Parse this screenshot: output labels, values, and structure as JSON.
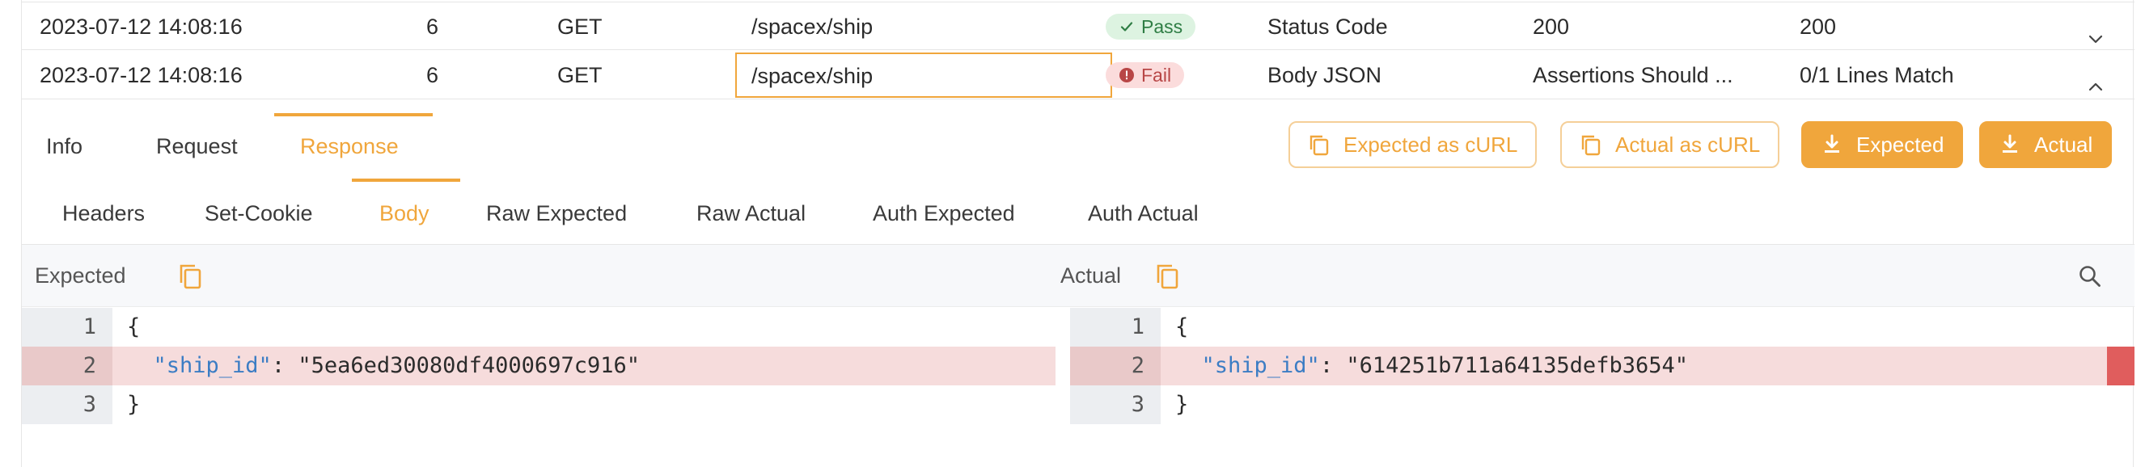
{
  "rows": [
    {
      "time": "2023-07-12 14:08:16",
      "num": "6",
      "method": "GET",
      "path": "/spacex/ship",
      "status": "Pass",
      "type": "Status Code",
      "expected": "200",
      "actual": "200",
      "chevron_icon": "chevron-down-icon"
    },
    {
      "time": "2023-07-12 14:08:16",
      "num": "6",
      "method": "GET",
      "path": "/spacex/ship",
      "status": "Fail",
      "type": "Body JSON",
      "expected": "Assertions Should ...",
      "actual": "0/1 Lines Match",
      "chevron_icon": "chevron-up-icon"
    }
  ],
  "tabs": [
    {
      "label": "Info"
    },
    {
      "label": "Request"
    },
    {
      "label": "Response",
      "active": true
    }
  ],
  "actions": {
    "expected_curl": "Expected as cURL",
    "actual_curl": "Actual as cURL",
    "expected": "Expected",
    "actual": "Actual"
  },
  "sub_tabs": [
    {
      "label": "Headers"
    },
    {
      "label": "Set-Cookie"
    },
    {
      "label": "Body",
      "active": true
    },
    {
      "label": "Raw Expected"
    },
    {
      "label": "Raw Actual"
    },
    {
      "label": "Auth Expected"
    },
    {
      "label": "Auth Actual"
    }
  ],
  "diff": {
    "expected_title": "Expected",
    "actual_title": "Actual",
    "expected_lines": [
      {
        "n": "1",
        "text": "{"
      },
      {
        "n": "2",
        "key": "\"ship_id\"",
        "rest": ": \"5ea6ed30080df4000697c916\"",
        "changed": true
      },
      {
        "n": "3",
        "text": "}"
      }
    ],
    "actual_lines": [
      {
        "n": "1",
        "text": "{"
      },
      {
        "n": "2",
        "key": "\"ship_id\"",
        "rest": ": \"614251b711a64135defb3654\"",
        "changed": true
      },
      {
        "n": "3",
        "text": "}"
      }
    ]
  },
  "colors": {
    "accent": "#f0a63c",
    "pass_bg": "#ddf3e1",
    "fail_bg": "#fbdcdc",
    "diff_changed": "#f6dcdc",
    "json_key": "#3c7dc4"
  }
}
